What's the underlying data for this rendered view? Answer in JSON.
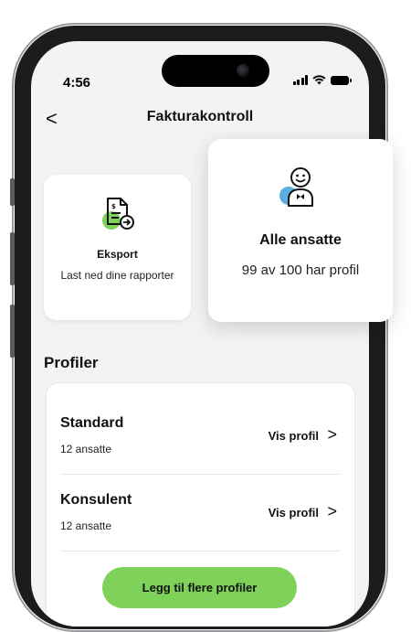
{
  "status_bar": {
    "time": "4:56"
  },
  "header": {
    "back_icon": "chevron-left-icon",
    "back_label": "<",
    "title": "Fakturakontroll"
  },
  "cards": {
    "export": {
      "icon": "export-document-icon",
      "title": "Eksport",
      "subtitle": "Last ned dine rapporter"
    },
    "all_employees": {
      "icon": "employee-avatar-icon",
      "title": "Alle ansatte",
      "subtitle": "99 av 100 har profil"
    }
  },
  "profiles": {
    "title": "Profiler",
    "items": [
      {
        "name": "Standard",
        "count": "12 ansatte",
        "action": "Vis profil",
        "chevron": ">"
      },
      {
        "name": "Konsulent",
        "count": "12 ansatte",
        "action": "Vis profil",
        "chevron": ">"
      }
    ],
    "add_button": "Legg til flere profiler"
  },
  "colors": {
    "accent_green": "#7ed25a",
    "accent_blue": "#5aaee0",
    "background": "#f3f4f2"
  }
}
